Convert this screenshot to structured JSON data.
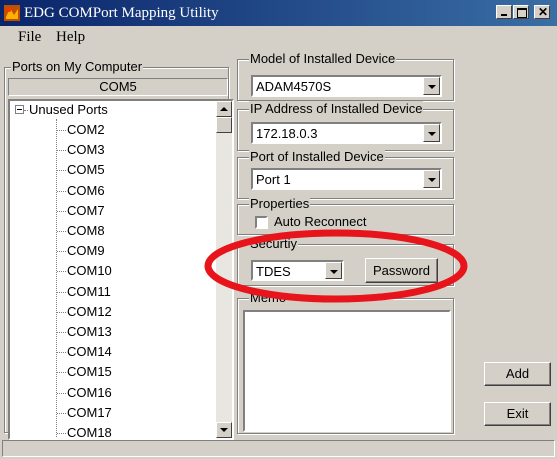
{
  "window": {
    "title": "EDG COMPort Mapping Utility"
  },
  "menu": {
    "file": "File",
    "help": "Help"
  },
  "ports_panel": {
    "title": "Ports on My Computer",
    "selected_port": "COM5",
    "tree_root": "Unused Ports",
    "ports": [
      "COM2",
      "COM3",
      "COM5",
      "COM6",
      "COM7",
      "COM8",
      "COM9",
      "COM10",
      "COM11",
      "COM12",
      "COM13",
      "COM14",
      "COM15",
      "COM16",
      "COM17",
      "COM18"
    ]
  },
  "model": {
    "title": "Model of Installed Device",
    "value": "ADAM4570S"
  },
  "ip": {
    "title": "IP Address of Installed Device",
    "value": "172.18.0.3"
  },
  "port": {
    "title": "Port of Installed Device",
    "value": "Port 1"
  },
  "properties": {
    "title": "Properties",
    "auto_reconnect_label": "Auto Reconnect",
    "auto_reconnect_checked": false
  },
  "security": {
    "title": "Securtiy",
    "mode": "TDES",
    "password_button": "Password"
  },
  "memo": {
    "title": "Memo",
    "value": ""
  },
  "buttons": {
    "add": "Add",
    "exit": "Exit"
  },
  "colors": {
    "titlebar": "#0a246a",
    "face": "#d4d0c8",
    "annotation_ellipse": "#e8141b"
  }
}
